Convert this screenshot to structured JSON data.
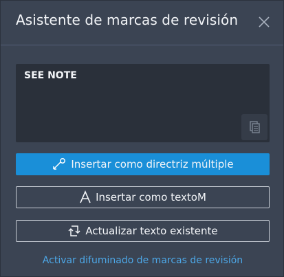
{
  "dialog": {
    "title": "Asistente de marcas de revisión",
    "close_icon": "close-icon"
  },
  "textarea": {
    "value": "SEE NOTE",
    "copy_icon": "copy-icon"
  },
  "buttons": {
    "insert_mleader": {
      "label": "Insertar como directriz múltiple",
      "icon": "multileader-icon"
    },
    "insert_mtext": {
      "label": "Insertar como textoM",
      "icon": "text-a-icon"
    },
    "update_text": {
      "label": "Actualizar texto existente",
      "icon": "update-text-icon"
    }
  },
  "link": {
    "label": "Activar difuminado de marcas de revisión"
  },
  "colors": {
    "background": "#3b4453",
    "primary_button": "#1a8fd8",
    "link": "#4da8e8",
    "textarea": "#2a303a"
  }
}
